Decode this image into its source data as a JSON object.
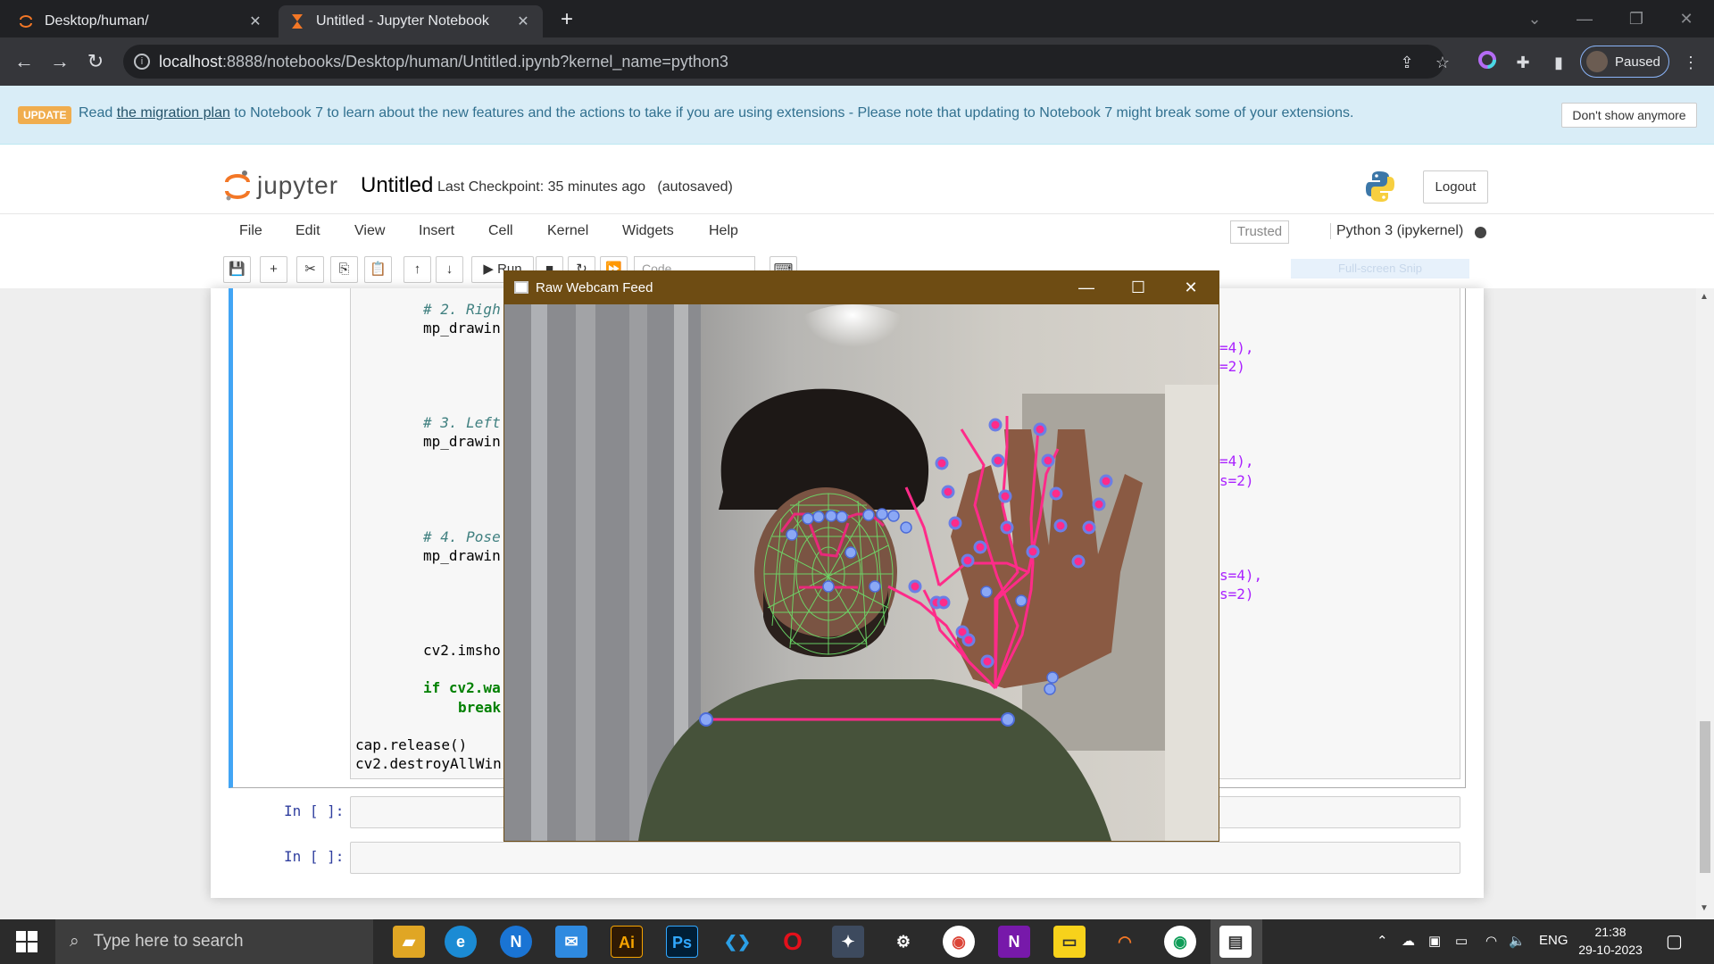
{
  "browser": {
    "tabs": [
      {
        "label": "Desktop/human/",
        "active": false
      },
      {
        "label": "Untitled - Jupyter Notebook",
        "active": true
      }
    ],
    "url_host": "localhost",
    "url_path": ":8888/notebooks/Desktop/human/Untitled.ipynb?kernel_name=python3",
    "profile_label": "Paused"
  },
  "banner": {
    "badge": "UPDATE",
    "text_before": "Read ",
    "link": "the migration plan",
    "text_after": " to Notebook 7 to learn about the new features and the actions to take if you are using extensions - Please note that updating to Notebook 7 might break some of your extensions.",
    "dismiss": "Don't show anymore"
  },
  "jupyter": {
    "logo_text": "jupyter",
    "notebook_name": "Untitled",
    "checkpoint": "Last Checkpoint: 35 minutes ago",
    "autosaved": "(autosaved)",
    "logout": "Logout",
    "menu": [
      "File",
      "Edit",
      "View",
      "Insert",
      "Cell",
      "Kernel",
      "Widgets",
      "Help"
    ],
    "trusted": "Trusted",
    "kernel": "Python 3 (ipykernel)",
    "run_label": "Run",
    "cell_type": "Code",
    "snip_hint": "Full-screen Snip"
  },
  "code": {
    "comment_right": "# 2. Righ",
    "call_right": "mp_drawin",
    "comment_left": "# 3. Left",
    "call_left": "mp_drawin",
    "comment_pose": "# 4. Pose",
    "call_pose": "mp_drawin",
    "imshow": "cv2.imsho",
    "if_line": "if cv2.wa",
    "break_line": "break",
    "release": "cap.release()",
    "destroy": "cv2.destroyAllWin",
    "right_tail_1": "=4),",
    "right_tail_2": "=2)",
    "left_tail_1": "=4),",
    "left_tail_2": "s=2)",
    "pose_tail_1": "s=4),",
    "pose_tail_2": "s=2)"
  },
  "prompts": [
    "In [ ]:",
    "In [ ]:"
  ],
  "webcam": {
    "title": "Raw Webcam Feed"
  },
  "taskbar": {
    "search_placeholder": "Type here to search",
    "lang": "ENG",
    "time": "21:38",
    "date": "29-10-2023"
  }
}
